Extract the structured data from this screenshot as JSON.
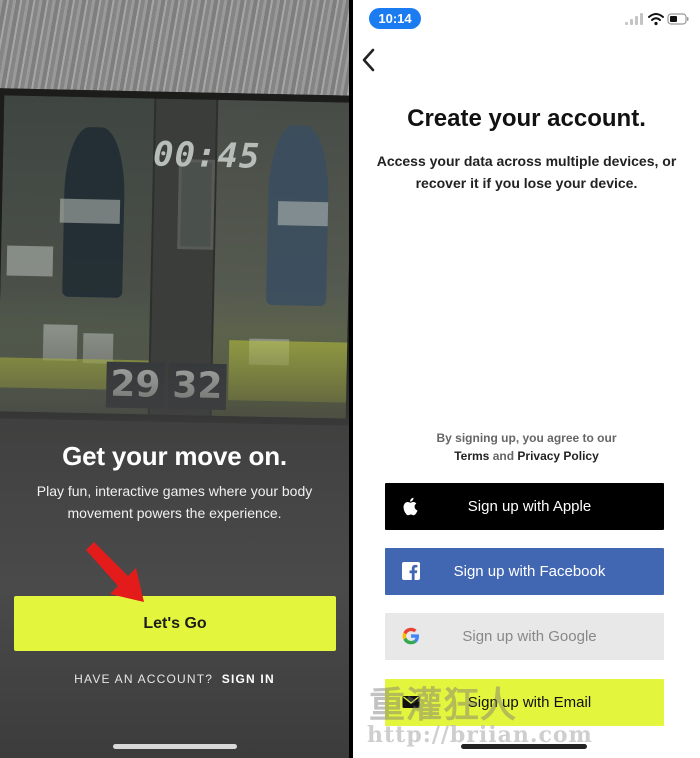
{
  "onboarding": {
    "headline": "Get your move on.",
    "subtitle": "Play fun, interactive games where your body movement powers the experience.",
    "cta_label": "Let's Go",
    "account_prompt": "HAVE AN ACCOUNT?",
    "sign_in_label": "SIGN IN",
    "game_timer": "00:45",
    "score_left": "29",
    "score_right": "32",
    "cta_color": "#e3f53d"
  },
  "signup": {
    "status_time": "10:14",
    "title": "Create your account.",
    "description": "Access your data across multiple devices, or recover it if you lose your device.",
    "agree_text": "By signing up, you agree to our",
    "terms_label": "Terms",
    "and_text": "and",
    "privacy_label": "Privacy Policy",
    "buttons": [
      {
        "label": "Sign up with Apple",
        "icon": "apple-icon",
        "color": "#000000"
      },
      {
        "label": "Sign up with Facebook",
        "icon": "facebook-icon",
        "color": "#4267b2"
      },
      {
        "label": "Sign up with Google",
        "icon": "google-icon",
        "color": "#e8e8e8"
      },
      {
        "label": "Sign up with Email",
        "icon": "envelope-icon",
        "color": "#e3f53d"
      }
    ]
  },
  "watermark": {
    "text_cn": "重灌狂人",
    "url": "http://briian.com"
  }
}
